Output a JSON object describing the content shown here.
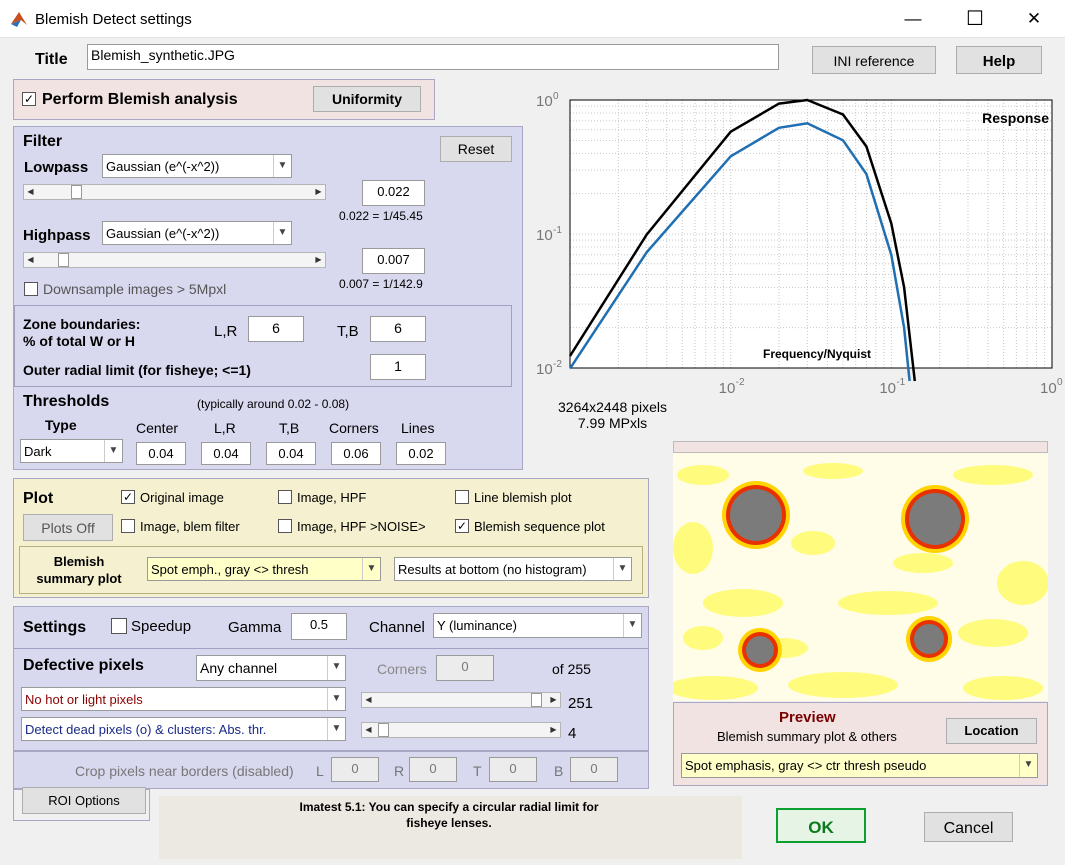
{
  "window": {
    "title": "Blemish Detect settings",
    "min": "—",
    "max": "☐",
    "close": "✕"
  },
  "header": {
    "title_label": "Title",
    "title_value": "Blemish_synthetic.JPG",
    "ini_btn": "INI reference",
    "help_btn": "Help"
  },
  "blemish": {
    "perform_label": "Perform Blemish analysis",
    "perform_checked": "✓",
    "uniformity_btn": "Uniformity"
  },
  "filter": {
    "title": "Filter",
    "reset_btn": "Reset",
    "lowpass_label": "Lowpass",
    "lowpass_type": "Gaussian (e^(-x^2))",
    "lowpass_value": "0.022",
    "lowpass_note": "0.022 = 1/45.45",
    "lowpass_level": 0.13,
    "highpass_label": "Highpass",
    "highpass_type": "Gaussian (e^(-x^2))",
    "highpass_value": "0.007",
    "highpass_note": "0.007 = 1/142.9",
    "highpass_level": 0.08,
    "downsample_label": "Downsample images > 5Mpxl"
  },
  "zones": {
    "label1": "Zone boundaries:",
    "label2": "% of total W or H",
    "lr_label": "L,R",
    "lr_value": "6",
    "tb_label": "T,B",
    "tb_value": "6",
    "radial_label": "Outer radial limit (for fisheye; <=1)",
    "radial_value": "1"
  },
  "thresholds": {
    "title": "Thresholds",
    "note": "(typically around 0.02 - 0.08)",
    "type_label": "Type",
    "type_value": "Dark",
    "center_label": "Center",
    "center_value": "0.04",
    "lr_label": "L,R",
    "lr_value": "0.04",
    "tb_label": "T,B",
    "tb_value": "0.04",
    "corners_label": "Corners",
    "corners_value": "0.06",
    "lines_label": "Lines",
    "lines_value": "0.02"
  },
  "plot": {
    "title": "Plot",
    "plots_off_btn": "Plots Off",
    "original_image": "Original image",
    "image_blem_filter": "Image, blem filter",
    "image_hpf": "Image, HPF",
    "image_hpf_noise": "Image, HPF >NOISE>",
    "line_blemish": "Line blemish plot",
    "blemish_sequence": "Blemish sequence plot",
    "check": "✓",
    "summary_label1": "Blemish",
    "summary_label2": "summary plot",
    "summary_select": "Spot emph., gray <> thresh",
    "results_select": "Results at bottom (no histogram)"
  },
  "settings": {
    "title": "Settings",
    "speedup_label": "Speedup",
    "gamma_label": "Gamma",
    "gamma_value": "0.5",
    "channel_label": "Channel",
    "channel_value": "Y (luminance)"
  },
  "defective": {
    "title": "Defective pixels",
    "channel_select": "Any channel",
    "corners_label": "Corners",
    "corners_value": "0",
    "of_label": "of 255",
    "hot_select": "No hot or light pixels",
    "hot_value": "251",
    "hot_level": 0.98,
    "dead_select": "Detect dead pixels (o) & clusters:  Abs. thr.",
    "dead_value": "4",
    "dead_level": 0.02
  },
  "crop": {
    "label": "Crop pixels near borders (disabled)",
    "l": "L",
    "l_val": "0",
    "r": "R",
    "r_val": "0",
    "t": "T",
    "t_val": "0",
    "b": "B",
    "b_val": "0",
    "roi_btn": "ROI Options"
  },
  "message": {
    "text": "Imatest 5.1: You can specify a circular radial limit for fisheye lenses."
  },
  "chart_data": {
    "type": "line",
    "title": "Response",
    "xlabel": "Frequency/Nyquist",
    "xscale": "log",
    "yscale": "log",
    "xlim": [
      0.001,
      1
    ],
    "ylim": [
      0.01,
      1
    ],
    "x_ticks": [
      "10",
      "10",
      "10"
    ],
    "x_exps": [
      "-2",
      "-1",
      "0"
    ],
    "y_ticks": [
      "10",
      "10",
      "10"
    ],
    "y_exps": [
      "0",
      "-1",
      "-2"
    ],
    "grid": true,
    "series": [
      {
        "color": "#000000",
        "x": [
          0.001,
          0.003,
          0.01,
          0.02,
          0.03,
          0.05,
          0.07,
          0.1,
          0.12,
          0.14
        ],
        "y": [
          0.0123,
          0.099,
          0.58,
          0.94,
          1.0,
          0.78,
          0.45,
          0.12,
          0.04,
          0.008
        ]
      },
      {
        "color": "#1f6fb2",
        "x": [
          0.001,
          0.003,
          0.01,
          0.02,
          0.03,
          0.05,
          0.07,
          0.1,
          0.12,
          0.13
        ],
        "y": [
          0.0099,
          0.073,
          0.38,
          0.62,
          0.67,
          0.5,
          0.28,
          0.07,
          0.02,
          0.008
        ]
      }
    ]
  },
  "image_info": {
    "pixels": "3264x2448 pixels",
    "mpx": "7.99 MPxls"
  },
  "preview": {
    "title": "Preview",
    "subtitle": "Blemish summary plot & others",
    "location_btn": "Location",
    "select": "Spot emphasis, gray <> ctr thresh   pseudo"
  },
  "footer": {
    "ok_btn": "OK",
    "cancel_btn": "Cancel"
  }
}
